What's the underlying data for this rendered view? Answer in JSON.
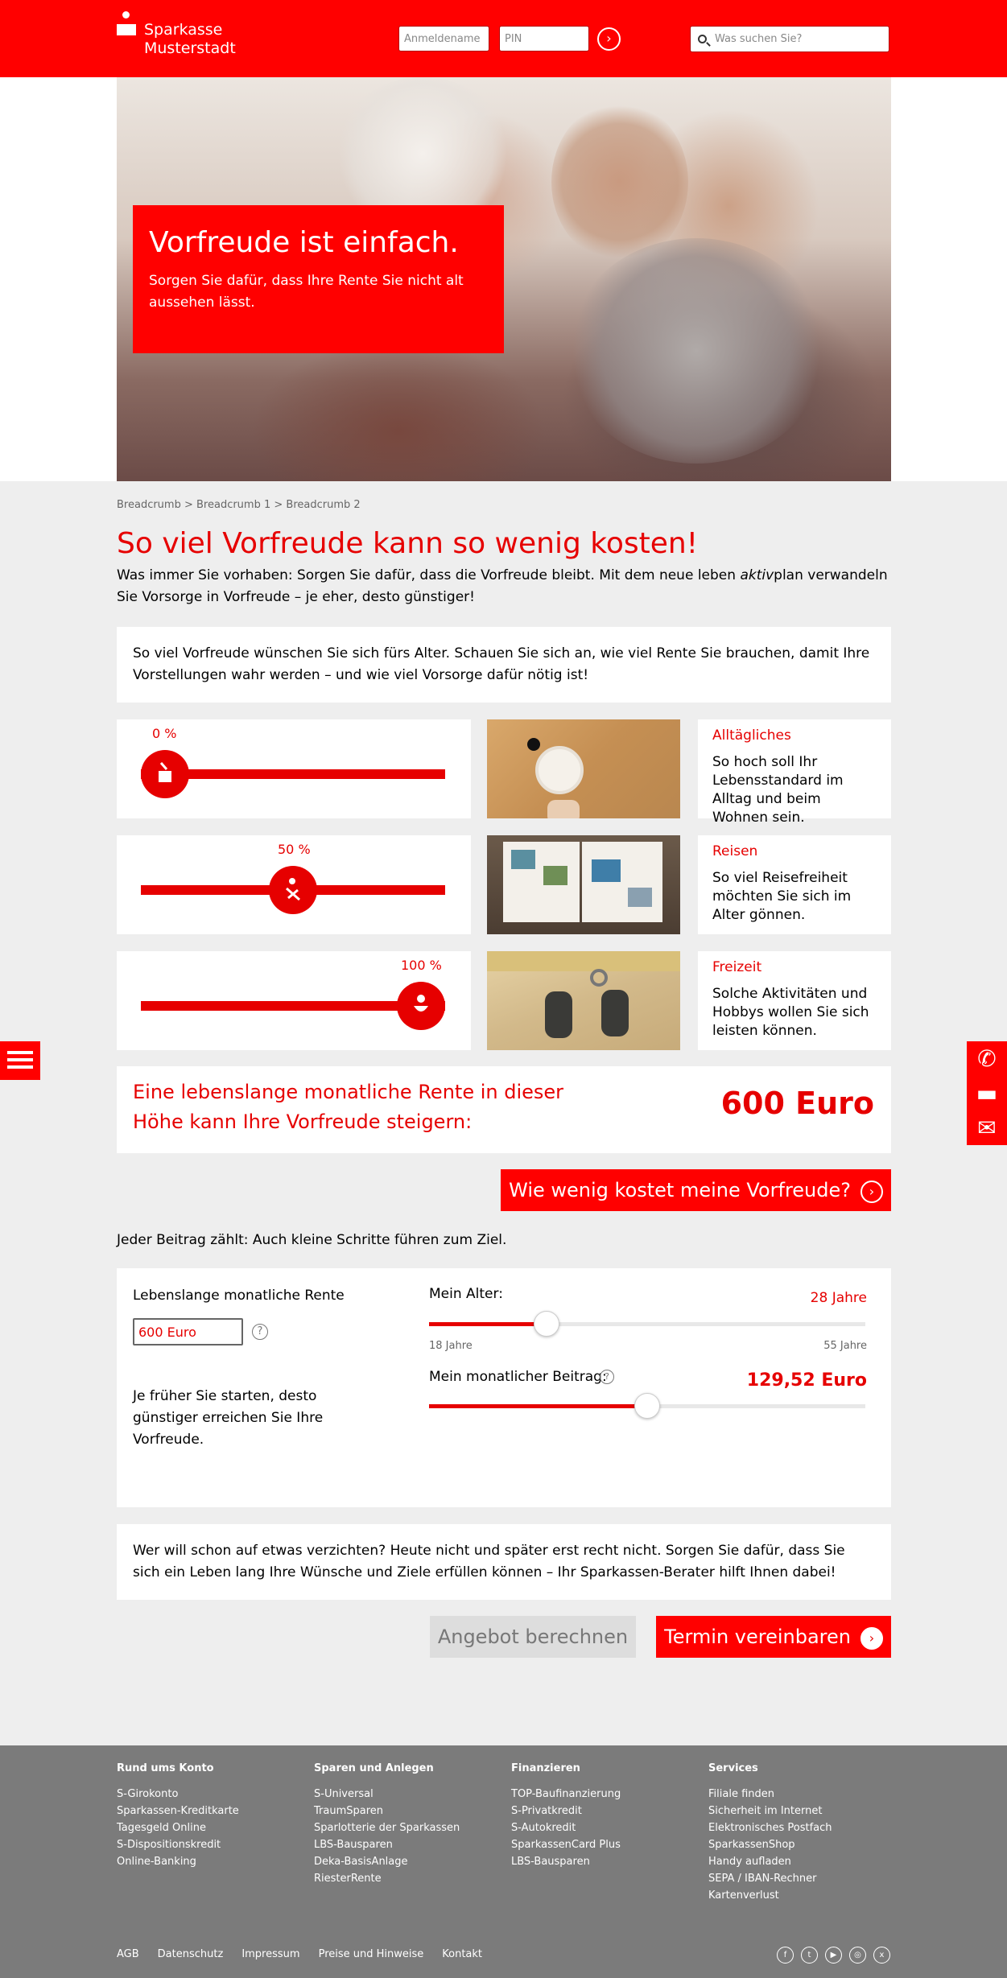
{
  "brand": {
    "line1": "Sparkasse",
    "line2": "Musterstadt",
    "red": "#ff0000",
    "text_red": "#e60000"
  },
  "header": {
    "login_placeholder": "Anmeldename",
    "pin_placeholder": "PIN",
    "go_icon": "chevron-right-icon",
    "search_placeholder": "Was suchen Sie?"
  },
  "hero": {
    "title": "Vorfreude ist einfach.",
    "subtitle": "Sorgen Sie dafür, dass Ihre Rente Sie nicht alt aussehen lässt."
  },
  "breadcrumb": "Breadcrumb > Breadcrumb 1 > Breadcrumb 2",
  "main": {
    "heading": "So viel Vorfreude kann so wenig kosten!",
    "intro_part1": "Was immer Sie vorhaben: Sorgen Sie dafür, dass die Vorfreude bleibt. Mit dem neue leben ",
    "intro_italic": "aktiv",
    "intro_part2": "plan verwandeln Sie Vorsorge in Vorfreude – je eher, desto günstiger!",
    "box_text": "So viel Vorfreude wünschen Sie sich fürs Alter. Schauen Sie sich an, wie viel Rente Sie brauchen, damit Ihre Vorstellungen wahr werden – und wie viel Vorsorge dafür nötig ist!"
  },
  "rows": [
    {
      "percent_label": "0 %",
      "level": 0,
      "icon": "coffee-cup-icon",
      "title": "Alltägliches",
      "body": "So hoch soll Ihr Lebensstandard im Alltag und beim Wohnen sein.",
      "photo": "breakfast-photo"
    },
    {
      "percent_label": "50 %",
      "level": 50,
      "icon": "deck-chair-icon",
      "title": "Reisen",
      "body": "So viel Reisefreiheit möchten Sie sich im Alter gönnen.",
      "photo": "photo-album-photo"
    },
    {
      "percent_label": "100 %",
      "level": 100,
      "icon": "smiley-icon",
      "title": "Freizeit",
      "body": "Solche Aktivitäten und Hobbys wollen Sie sich leisten können.",
      "photo": "boots-photo"
    }
  ],
  "rente": {
    "text": "Eine lebenslange monatliche Rente in dieser Höhe kann Ihre Vorfreude steigern:",
    "value": "600 Euro"
  },
  "cta": {
    "label": "Wie wenig kostet meine Vorfreude?"
  },
  "note": "Jeder Beitrag zählt: Auch kleine Schritte führen zum Ziel.",
  "calc": {
    "rente_label": "Lebenslange monatliche Rente",
    "rente_value": "600 Euro",
    "help": "?",
    "note": "Je früher Sie starten, desto günstiger erreichen Sie Ihre Vorfreude.",
    "age_label": "Mein Alter:",
    "age_value": "28 Jahre",
    "age_min": "18 Jahre",
    "age_max": "55 Jahre",
    "age_level": 0.27,
    "beitrag_label": "Mein monatlicher Beitrag:",
    "beitrag_value": "129,52 Euro",
    "beitrag_level": 0.5
  },
  "final": {
    "text": "Wer will schon auf etwas verzichten? Heute nicht und später erst recht nicht. Sorgen Sie dafür, dass Sie sich ein Leben lang Ihre Wünsche und Ziele erfüllen können – Ihr Sparkassen-Berater hilft Ihnen dabei!",
    "btn_secondary": "Angebot berechnen",
    "btn_primary": "Termin vereinbaren"
  },
  "footer": {
    "columns": [
      {
        "title": "Rund ums Konto",
        "items": [
          "S-Girokonto",
          "Sparkassen-Kreditkarte",
          "Tagesgeld Online",
          "S-Dispositionskredit",
          "Online-Banking"
        ]
      },
      {
        "title": "Sparen und Anlegen",
        "items": [
          "S-Universal",
          "TraumSparen",
          "Sparlotterie der Sparkassen",
          "LBS-Bausparen",
          "Deka-BasisAnlage",
          "RiesterRente"
        ]
      },
      {
        "title": "Finanzieren",
        "items": [
          "TOP-Baufinanzierung",
          "S-Privatkredit",
          "S-Autokredit",
          "SparkassenCard Plus",
          "LBS-Bausparen"
        ]
      },
      {
        "title": "Services",
        "items": [
          "Filiale finden",
          "Sicherheit im Internet",
          "Elektronisches Postfach",
          "SparkassenShop",
          "Handy aufladen",
          "SEPA / IBAN-Rechner",
          "Kartenverlust"
        ]
      }
    ],
    "bottom_links": [
      "AGB",
      "Datenschutz",
      "Impressum",
      "Preise und Hinweise",
      "Kontakt"
    ],
    "socials": [
      "facebook-icon",
      "twitter-icon",
      "youtube-icon",
      "instagram-icon",
      "xing-icon"
    ]
  },
  "side": {
    "menu_icon": "hamburger-menu-icon",
    "contact_icons": [
      "phone-icon",
      "chat-icon",
      "mail-icon"
    ]
  }
}
